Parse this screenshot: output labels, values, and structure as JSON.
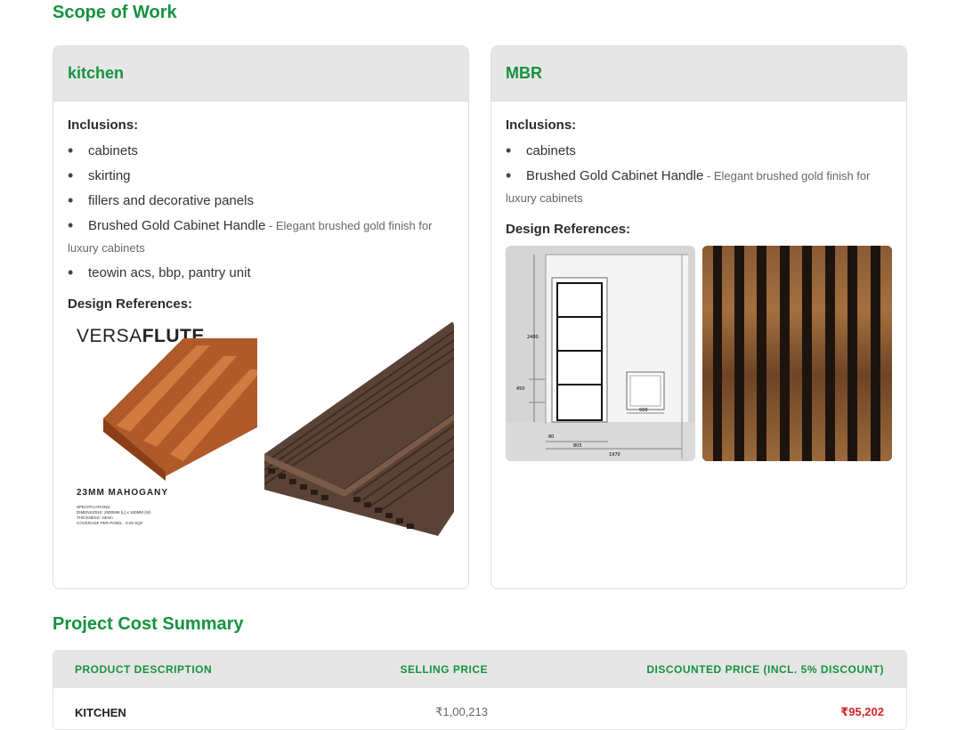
{
  "scope_title": "Scope of Work",
  "cards": [
    {
      "title": "kitchen",
      "inclusions_label": "Inclusions:",
      "items": [
        {
          "name": "cabinets"
        },
        {
          "name": "skirting"
        },
        {
          "name": "fillers and decorative panels"
        },
        {
          "name": "Brushed Gold Cabinet Handle",
          "desc": " - Elegant brushed gold finish for luxury cabinets"
        },
        {
          "name": "teowin acs, bbp, pantry unit"
        }
      ],
      "design_label": "Design References:",
      "images": [
        {
          "logo_light": "VERSA",
          "logo_bold": "FLUTE",
          "caption": "23MM MAHOGANY",
          "spec_lines": [
            "SPECIFICATIONS:",
            "DIMENSIONS: 2900MM (L) x 160MM (W)",
            "THICKNESS: 23mm",
            "COVERAGE PER PANEL : 5.00 SQF"
          ]
        },
        {
          "icon": "decking-image"
        }
      ]
    },
    {
      "title": "MBR",
      "inclusions_label": "Inclusions:",
      "items": [
        {
          "name": "cabinets"
        },
        {
          "name": "Brushed Gold Cabinet Handle",
          "desc": " - Elegant brushed gold finish for luxury cabinets"
        }
      ],
      "design_label": "Design References:",
      "images": [
        {
          "dims": [
            "2400",
            "450",
            "500",
            "805",
            "1970",
            "80"
          ]
        },
        {
          "icon": "wood-slat-image"
        }
      ]
    }
  ],
  "cost_title": "Project Cost Summary",
  "table": {
    "headers": [
      "PRODUCT DESCRIPTION",
      "SELLING PRICE",
      "DISCOUNTED PRICE (INCL. 5% DISCOUNT)"
    ],
    "rows": [
      {
        "product": "KITCHEN",
        "selling": "₹1,00,213",
        "discounted": "₹95,202"
      }
    ]
  },
  "colors": {
    "accent": "#15933f",
    "discount": "#d1242f",
    "header_bg": "#e6e6e6"
  }
}
